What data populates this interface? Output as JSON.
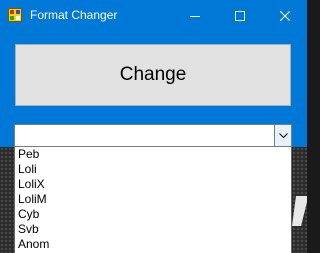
{
  "window": {
    "title": "Format Changer",
    "icon": "app-icon",
    "controls": [
      "minimize-icon",
      "maximize-icon",
      "close-icon"
    ]
  },
  "change_button": {
    "label": "Change"
  },
  "format_combo": {
    "selected": "",
    "expanded": true,
    "options": [
      "Peb",
      "Loli",
      "LoliX",
      "LoliM",
      "Cyb",
      "Svb",
      "Anom"
    ]
  },
  "colors": {
    "titlebar": "#0078d7",
    "button_face": "#e1e1e1"
  }
}
